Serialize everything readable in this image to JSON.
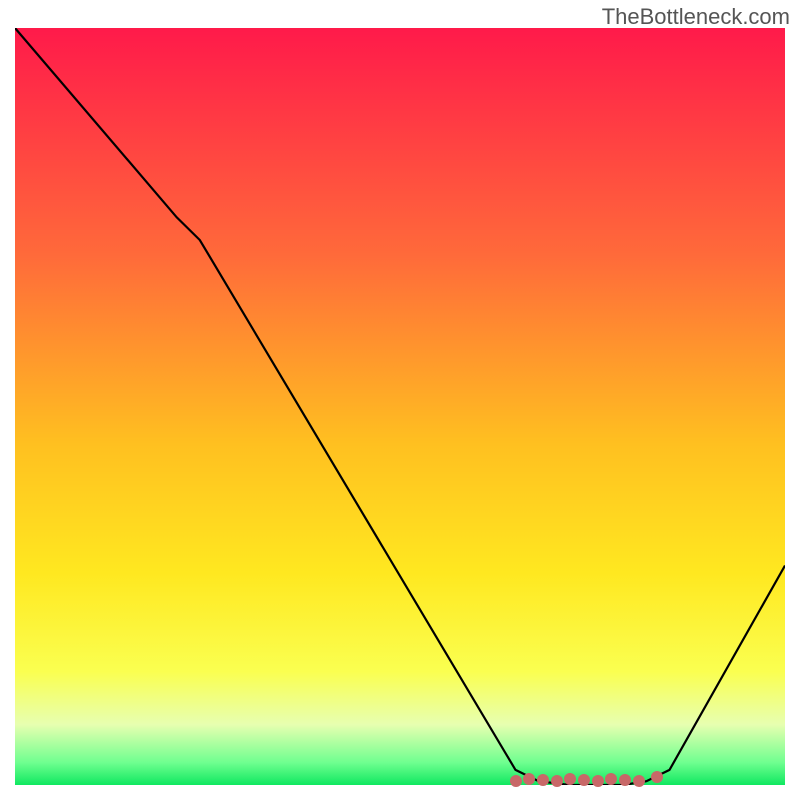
{
  "watermark": "TheBottleneck.com",
  "chart_data": {
    "type": "line",
    "title": "",
    "xlabel": "",
    "ylabel": "",
    "xlim": [
      0,
      100
    ],
    "ylim": [
      0,
      100
    ],
    "gradient_stops": [
      {
        "offset": 0,
        "color": "#ff1a4a"
      },
      {
        "offset": 30,
        "color": "#ff6a3a"
      },
      {
        "offset": 55,
        "color": "#ffc020"
      },
      {
        "offset": 72,
        "color": "#ffe820"
      },
      {
        "offset": 85,
        "color": "#faff50"
      },
      {
        "offset": 92,
        "color": "#e7ffb0"
      },
      {
        "offset": 97,
        "color": "#70ff90"
      },
      {
        "offset": 100,
        "color": "#10e860"
      }
    ],
    "curve": [
      {
        "x": 0,
        "y": 100
      },
      {
        "x": 21,
        "y": 75
      },
      {
        "x": 24,
        "y": 72
      },
      {
        "x": 65,
        "y": 2
      },
      {
        "x": 68,
        "y": 0.5
      },
      {
        "x": 72,
        "y": 0
      },
      {
        "x": 79,
        "y": 0
      },
      {
        "x": 82,
        "y": 0.5
      },
      {
        "x": 85,
        "y": 2
      },
      {
        "x": 100,
        "y": 29
      }
    ],
    "highlight_range": {
      "start": 65,
      "end": 81,
      "label": ""
    },
    "highlight_color": "#c86868"
  }
}
